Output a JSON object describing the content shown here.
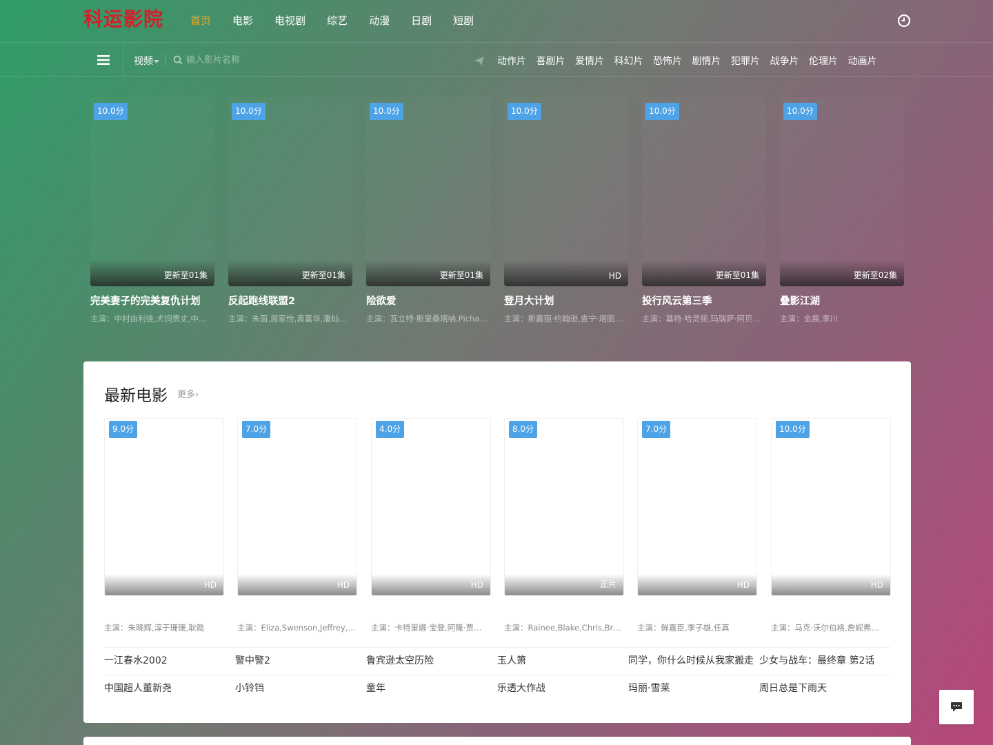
{
  "header": {
    "logo": "科运影院",
    "nav": [
      "首页",
      "电影",
      "电视剧",
      "综艺",
      "动漫",
      "日剧",
      "短剧"
    ],
    "active_index": 0,
    "history_icon": "clock-icon"
  },
  "toolbar": {
    "menu_icon": "hamburger-icon",
    "type_select": "视频",
    "search_placeholder": "输入影片名称",
    "categories": [
      "动作片",
      "喜剧片",
      "爱情片",
      "科幻片",
      "恐怖片",
      "剧情片",
      "犯罪片",
      "战争片",
      "伦理片",
      "动画片"
    ]
  },
  "hero": [
    {
      "score": "10.0分",
      "status": "更新至01集",
      "title": "完美妻子的完美复仇计划",
      "actors": "主演：中村由利佳,犬饲贵丈,中…"
    },
    {
      "score": "10.0分",
      "status": "更新至01集",
      "title": "反起跑线联盟2",
      "actors": "主演：朱茵,周家怡,袁富华,潘灿…"
    },
    {
      "score": "10.0分",
      "status": "更新至01集",
      "title": "险欲爱",
      "actors": "主演：瓦立特·斯里桑塔纳,Picha…"
    },
    {
      "score": "10.0分",
      "status": "HD",
      "title": "登月大计划",
      "actors": "主演：斯嘉丽·约翰逊,查宁·塔图…"
    },
    {
      "score": "10.0分",
      "status": "更新至01集",
      "title": "投行风云第三季",
      "actors": "主演：基特·哈灵顿,玛瑞萨·阿贝…"
    },
    {
      "score": "10.0分",
      "status": "更新至02集",
      "title": "叠影江湖",
      "actors": "主演：金晨,李川"
    }
  ],
  "latest": {
    "title": "最新电影",
    "more": "更多›",
    "cards": [
      {
        "score": "9.0分",
        "status": "HD",
        "actors": "主演：朱晓辉,淳于珊珊,耿懿"
      },
      {
        "score": "7.0分",
        "status": "HD",
        "actors": "主演：Eliza,Swenson,Jeffrey,C…"
      },
      {
        "score": "4.0分",
        "status": "HD",
        "actors": "主演：卡特里娜·宝登,阿隆·贾…"
      },
      {
        "score": "8.0分",
        "status": "正片",
        "actors": "主演：Rainee,Blake,Chris,Bru…"
      },
      {
        "score": "7.0分",
        "status": "HD",
        "actors": "主演：鲜嘉臣,李子雄,任真"
      },
      {
        "score": "10.0分",
        "status": "HD",
        "actors": "主演：马克·沃尔伯格,詹妮弗…"
      }
    ],
    "list_row1": [
      "一江春水2002",
      "警中警2",
      "鲁宾逊太空历险",
      "玉人箫",
      "同学，你什么时候从我家搬走",
      "少女与战车：最终章 第2话"
    ],
    "list_row2": [
      "中国超人董新尧",
      "小铃铛",
      "童年",
      "乐透大作战",
      "玛丽·雪莱",
      "周日总是下雨天"
    ]
  },
  "chat_icon": "chat-bubble-icon",
  "colors": {
    "logo": "#d21f2a",
    "active_nav": "#f0a722",
    "score_badge": "#4ea3e7"
  }
}
